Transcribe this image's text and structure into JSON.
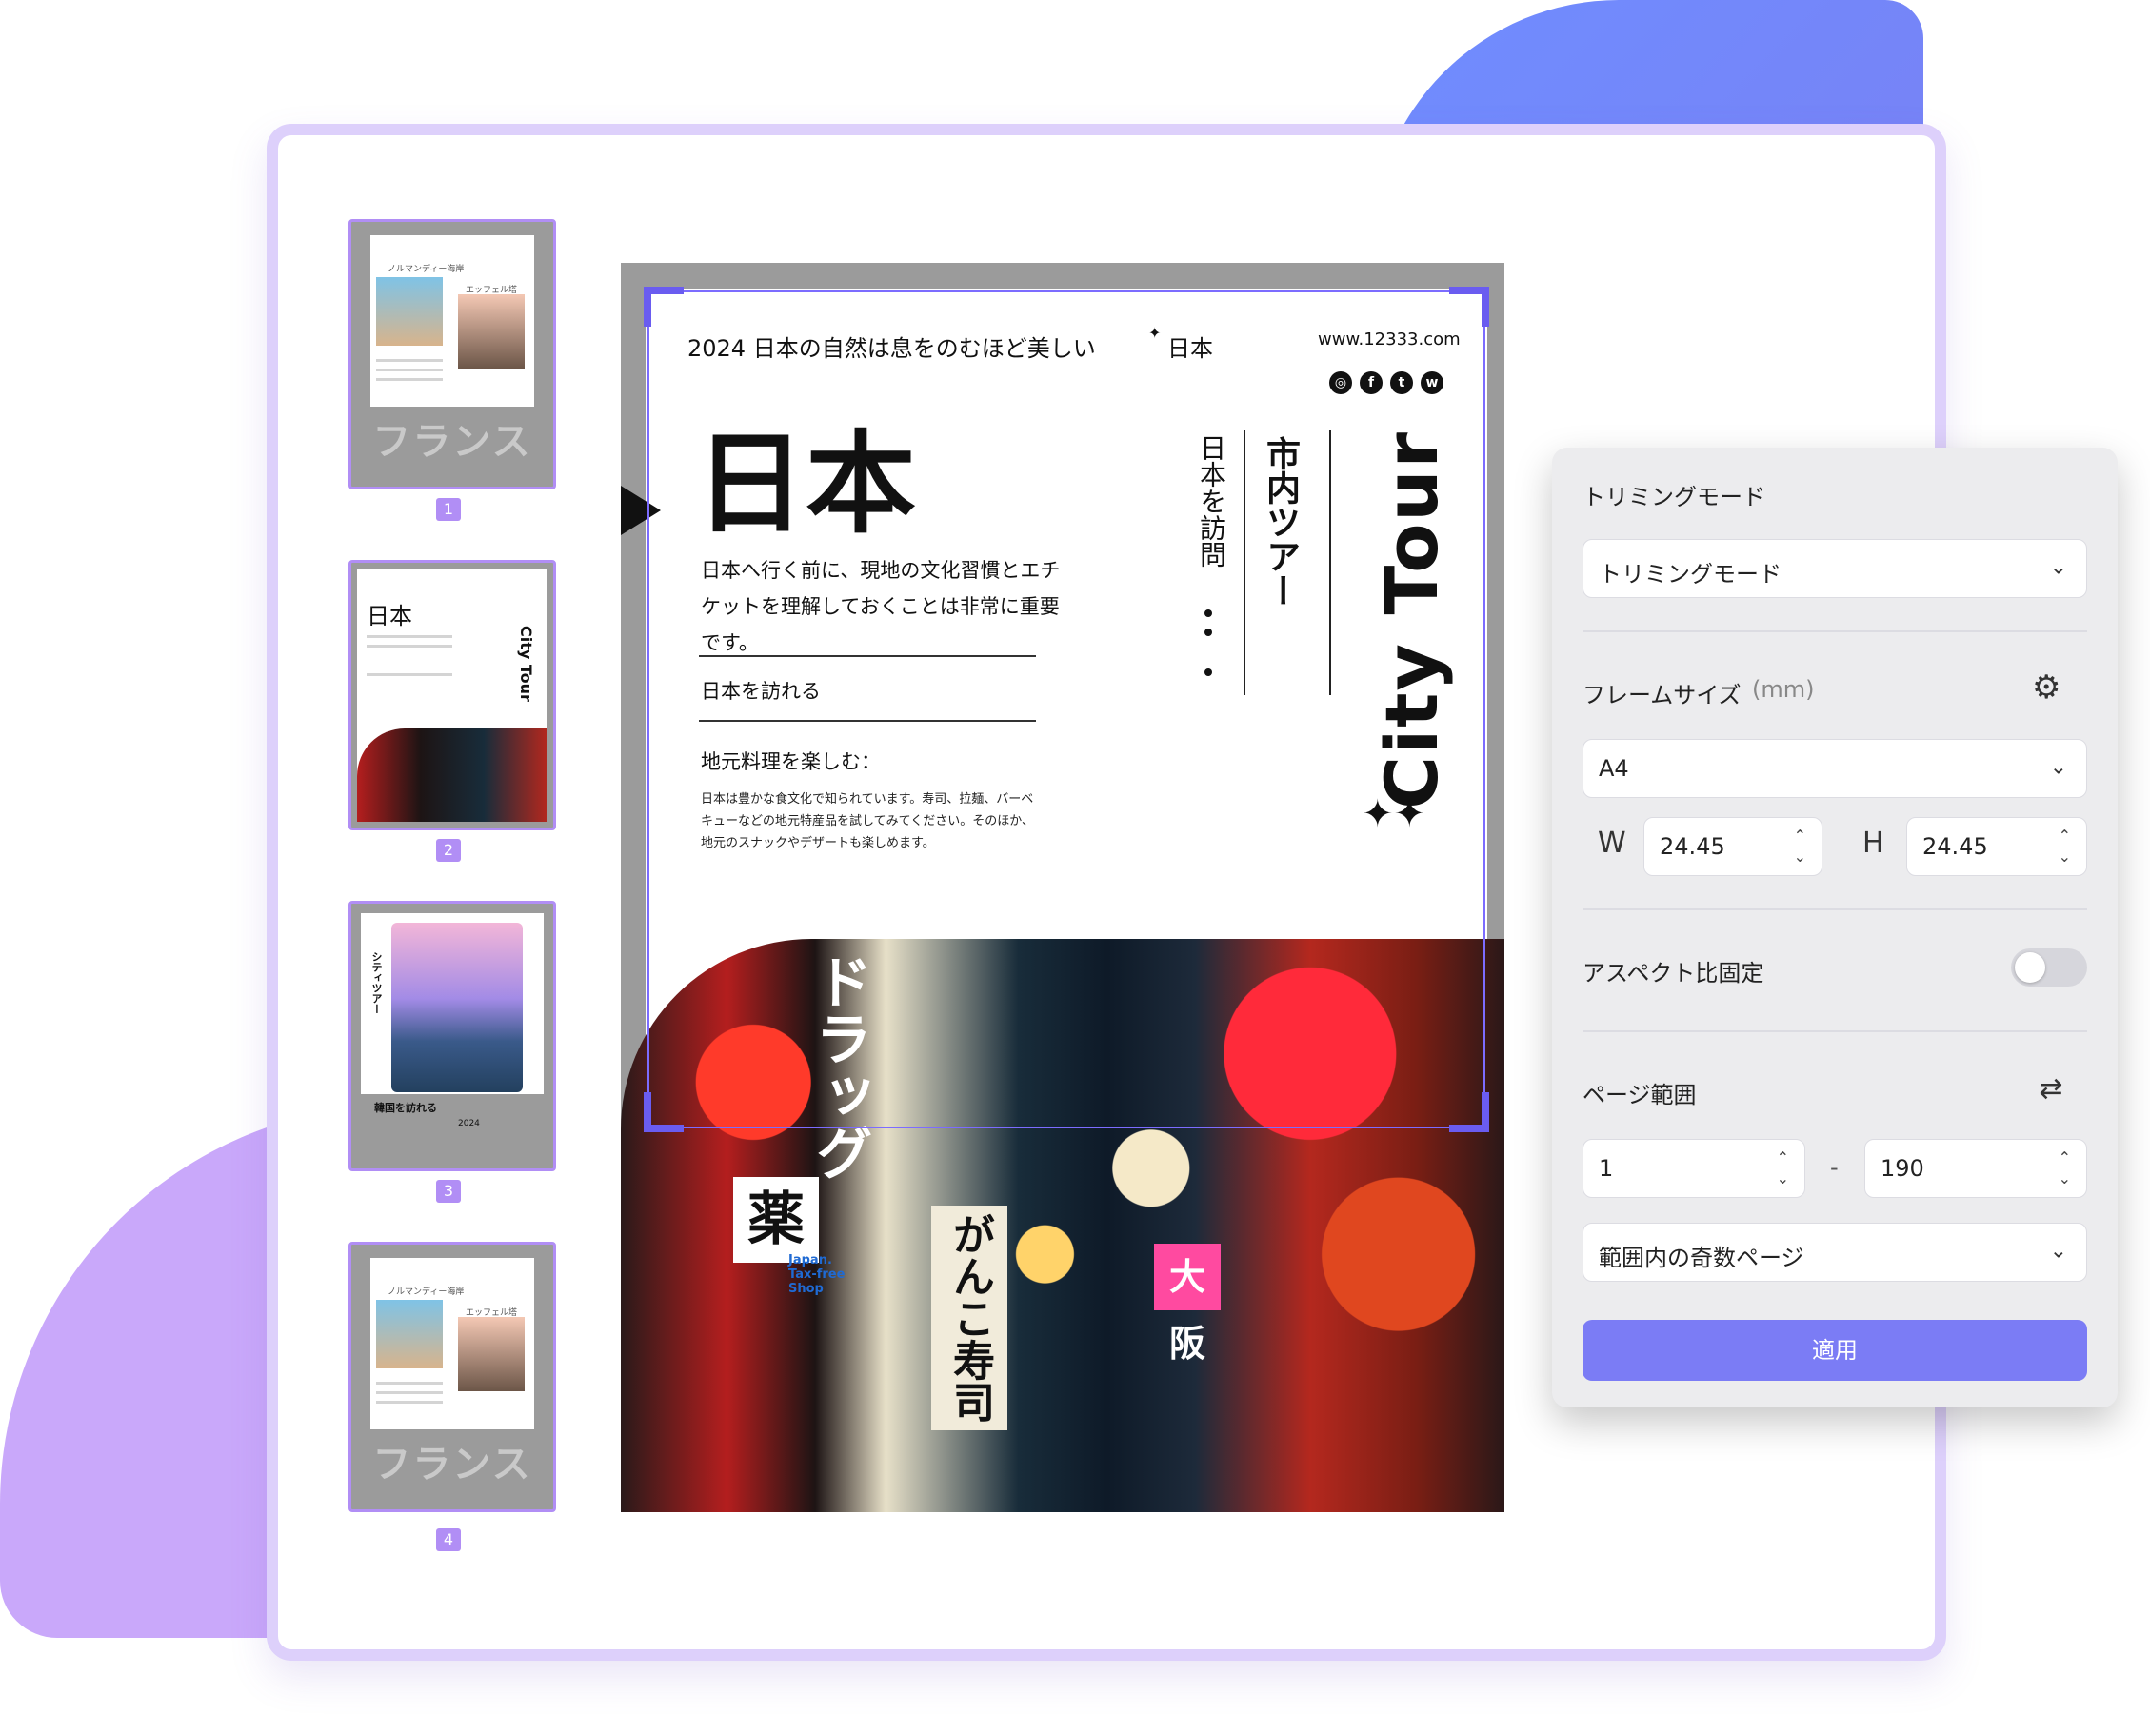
{
  "thumbnails": [
    {
      "number": "1",
      "title": "ノルマンディー海岸",
      "subtitle": "エッフェル塔",
      "big_text": "フランス"
    },
    {
      "number": "2",
      "title": "日本",
      "side": "City Tour"
    },
    {
      "number": "3",
      "title": "韓国を訪れる",
      "side": "シティツアー",
      "year": "2024"
    },
    {
      "number": "4",
      "title": "ノルマンディー海岸",
      "subtitle": "エッフェル塔",
      "big_text": "フランス"
    }
  ],
  "document": {
    "header_left": "2024 日本の自然は息をのむほど美しい",
    "header_mid": "日本",
    "header_url": "www.12333.com",
    "title": "日本",
    "intro": "日本へ行く前に、現地の文化習慣とエチケットを理解しておくことは非常に重要です。",
    "section1": "日本を訪れる",
    "section2": "地元料理を楽しむ：",
    "body": "日本は豊かな食文化で知られています。寿司、拉麺、バーベキューなどの地元特産品を試してみてください。そのほか、地元のスナックやデザートも楽しめます。",
    "vertical1": "日本を訪問",
    "vertical2": "市内ツアー",
    "vertical3": "City Tour",
    "photo_signs": [
      "ドラッグ",
      "薬",
      "がんこ寿司",
      "大阪",
      "Japan. Tax-free Shop"
    ]
  },
  "panel": {
    "trim_label": "トリミングモード",
    "trim_value": "トリミングモード",
    "frame_label": "フレームサイズ",
    "frame_unit": "(mm)",
    "frame_value": "A4",
    "w_label": "W",
    "w_value": "24.45",
    "h_label": "H",
    "h_value": "24.45",
    "aspect_label": "アスペクト比固定",
    "aspect_on": false,
    "range_label": "ページ範囲",
    "range_from": "1",
    "range_sep": "-",
    "range_to": "190",
    "range_mode": "範囲内の奇数ページ",
    "apply": "適用",
    "accent": "#7b7cf5"
  }
}
